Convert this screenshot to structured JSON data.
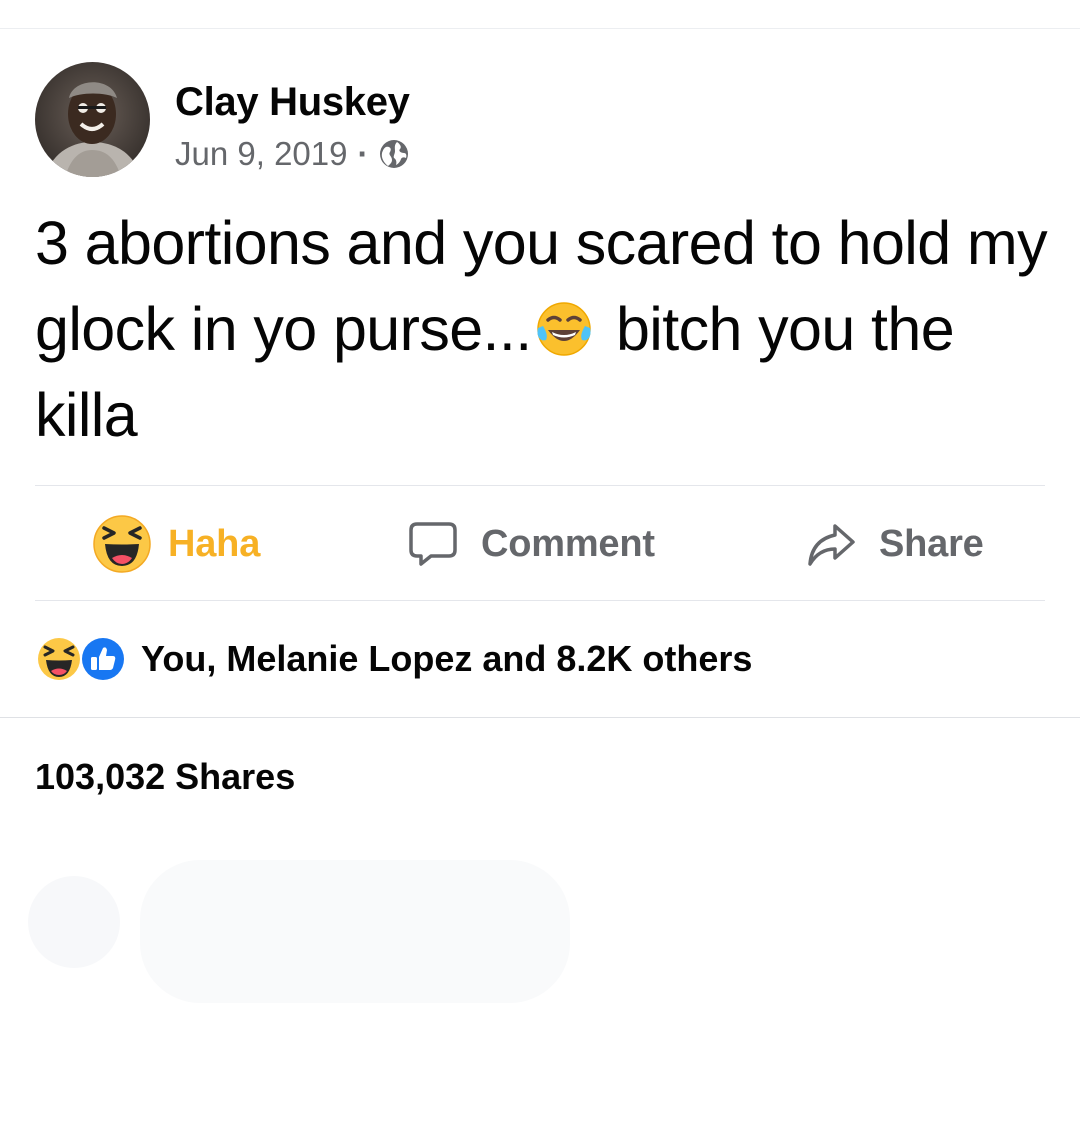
{
  "post": {
    "author": "Clay Huskey",
    "date": "Jun 9, 2019",
    "separator": "·",
    "privacy_icon": "globe-icon",
    "text_part1": "3 abortions and you scared to hold my glock in yo purse...",
    "inline_emoji": "tears-of-joy-emoji",
    "text_part2": " bitch you the killa"
  },
  "actions": {
    "haha_label": "Haha",
    "comment_label": "Comment",
    "share_label": "Share"
  },
  "reactions": {
    "icons": [
      "haha-icon",
      "like-icon"
    ],
    "summary": "You, Melanie Lopez and 8.2K others"
  },
  "shares": {
    "text": "103,032 Shares"
  },
  "colors": {
    "haha": "#f7b125",
    "like": "#1877f2",
    "secondary_text": "#65676b",
    "primary_text": "#050505"
  }
}
